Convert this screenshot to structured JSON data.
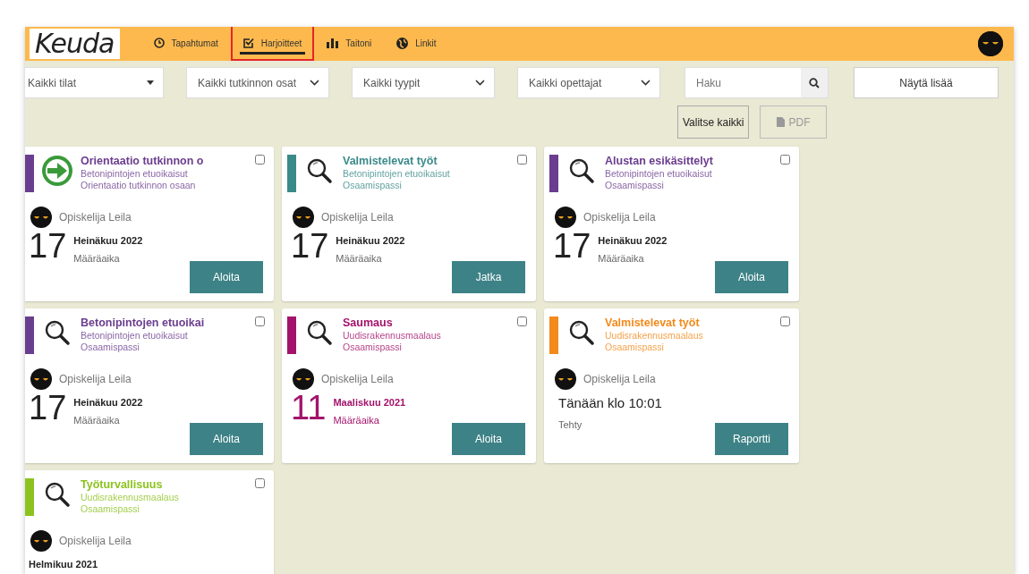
{
  "logo": "Keuda",
  "tabs": [
    {
      "label": "Tapahtumat",
      "selected": false,
      "highlighted": false
    },
    {
      "label": "Harjoitteet",
      "selected": true,
      "highlighted": true
    },
    {
      "label": "Taitoni",
      "selected": false,
      "highlighted": false
    },
    {
      "label": "Linkit",
      "selected": false,
      "highlighted": false
    }
  ],
  "filters": [
    {
      "value": "Kaikki tilat",
      "kind": "caret"
    },
    {
      "value": "Kaikki tutkinnon osat",
      "kind": "chevron"
    },
    {
      "value": "Kaikki tyypit",
      "kind": "chevron"
    },
    {
      "value": "Kaikki opettajat",
      "kind": "chevron"
    }
  ],
  "search": {
    "placeholder": "Haku"
  },
  "more_button": "Näytä lisää",
  "actions": [
    {
      "label": "Valitse kaikki",
      "disabled": false,
      "kind": "text"
    },
    {
      "label": "PDF",
      "disabled": true,
      "kind": "file"
    }
  ],
  "cards": [
    {
      "title": "Orientaatio tutkinnon o",
      "subtitle": "Betonipintojen etuoikaisut",
      "type": "Orientaatio tutkinnon osaan",
      "color": "#6b3d8e",
      "checked": false,
      "student": "Opiskelija Leila",
      "kind": "deadline",
      "overdue": false,
      "day": "17",
      "month": "Heinäkuu 2022",
      "date_label": "Määräaika",
      "button": "Aloita"
    },
    {
      "title": "Valmistelevat työt",
      "subtitle": "Betonipintojen etuoikaisut",
      "type": "Osaamispassi",
      "color": "#3a8a8a",
      "checked": false,
      "student": "Opiskelija Leila",
      "kind": "deadline",
      "overdue": false,
      "day": "17",
      "month": "Heinäkuu 2022",
      "date_label": "Määräaika",
      "button": "Jatka"
    },
    {
      "title": "Alustan esikäsittelyt",
      "subtitle": "Betonipintojen etuoikaisut",
      "type": "Osaamispassi",
      "color": "#6b3d8e",
      "checked": false,
      "student": "Opiskelija Leila",
      "kind": "deadline",
      "overdue": false,
      "day": "17",
      "month": "Heinäkuu 2022",
      "date_label": "Määräaika",
      "button": "Aloita"
    },
    {
      "title": "Betonipintojen etuoikai",
      "subtitle": "Betonipintojen etuoikaisut",
      "type": "Osaamispassi",
      "color": "#6b3d8e",
      "checked": false,
      "student": "Opiskelija Leila",
      "kind": "deadline",
      "overdue": false,
      "day": "17",
      "month": "Heinäkuu 2022",
      "date_label": "Määräaika",
      "button": "Aloita"
    },
    {
      "title": "Saumaus",
      "subtitle": "Uudisrakennusmaalaus",
      "type": "Osaamispassi",
      "color": "#a3136b",
      "checked": false,
      "student": "Opiskelija Leila",
      "kind": "deadline",
      "overdue": true,
      "day": "11",
      "month": "Maaliskuu 2021",
      "date_label": "Määräaika",
      "button": "Aloita"
    },
    {
      "title": "Valmistelevat työt",
      "subtitle": "Uudisrakennusmaalaus",
      "type": "Osaamispassi",
      "color": "#f28a1c",
      "checked": false,
      "student": "Opiskelija Leila",
      "kind": "completed",
      "time": "Tänään klo 10:01",
      "date_label": "Tehty",
      "button": "Raportti"
    },
    {
      "title": "Työturvallisuus",
      "subtitle": "Uudisrakennusmaalaus",
      "type": "Osaamispassi",
      "color": "#8cc21e",
      "checked": false,
      "student": "Opiskelija Leila",
      "kind": "deadline",
      "overdue": false,
      "month": "Helmikuu 2021"
    }
  ]
}
